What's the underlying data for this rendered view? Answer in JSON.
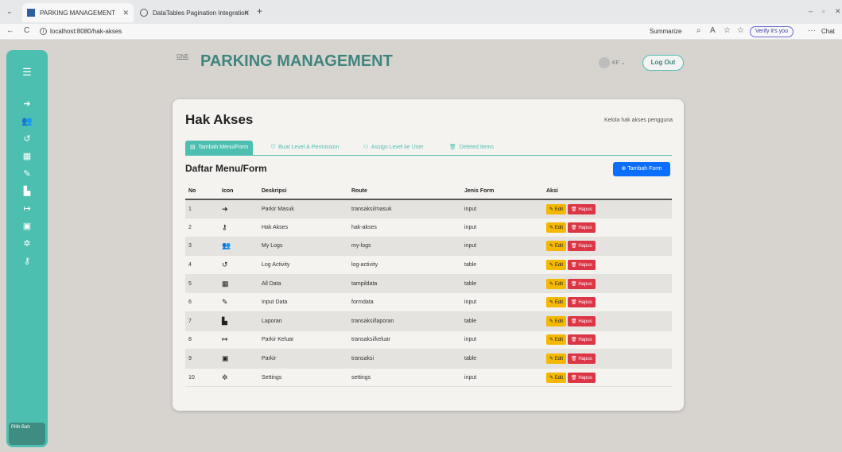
{
  "browser": {
    "tabs": [
      {
        "label": "PARKING MANAGEMENT"
      },
      {
        "label": "DataTables Pagination Integration"
      }
    ],
    "url": "localhost:8080/hak-akses",
    "summarize_label": "Summarize",
    "verify_label": "Verify it's you",
    "chat_label": "Chat"
  },
  "header": {
    "logo_text": "ONE",
    "title": "PARKING MANAGEMENT",
    "user": "KF",
    "logout_label": "Log Out"
  },
  "sidebar": {
    "bottom_label": "Pilih Bah",
    "items": [
      "menu",
      "sign-in",
      "users",
      "history",
      "table",
      "pencil",
      "file",
      "sign-out",
      "square",
      "gear",
      "key"
    ]
  },
  "card": {
    "title": "Hak Akses",
    "subtitle": "Kelola hak akses pengguna",
    "tabs": [
      {
        "label": "Tambah Menu/Form"
      },
      {
        "label": "Buat Level & Permission"
      },
      {
        "label": "Assign Level ke User"
      },
      {
        "label": "Deleted Items"
      }
    ],
    "list_title": "Daftar Menu/Form",
    "add_button": "Tambah Form"
  },
  "table": {
    "columns": [
      "No",
      "Icon",
      "Deskripsi",
      "Route",
      "Jenis Form",
      "Aksi"
    ],
    "edit_label": "Edit",
    "delete_label": "Hapus",
    "rows": [
      {
        "no": "1",
        "icon": "sign-in-icon",
        "deskripsi": "Parkir Masuk",
        "route": "transaksi/masuk",
        "jenis": "input"
      },
      {
        "no": "2",
        "icon": "key-icon",
        "deskripsi": "Hak Akses",
        "route": "hak-akses",
        "jenis": "input"
      },
      {
        "no": "3",
        "icon": "users-icon",
        "deskripsi": "My Logs",
        "route": "my-logs",
        "jenis": "input"
      },
      {
        "no": "4",
        "icon": "history-icon",
        "deskripsi": "Log Activity",
        "route": "log-activity",
        "jenis": "table"
      },
      {
        "no": "5",
        "icon": "table-icon",
        "deskripsi": "All Data",
        "route": "tampildata",
        "jenis": "table"
      },
      {
        "no": "6",
        "icon": "pencil-icon",
        "deskripsi": "Input Data",
        "route": "formdata",
        "jenis": "input"
      },
      {
        "no": "7",
        "icon": "file-icon",
        "deskripsi": "Laporan",
        "route": "transaksi/laporan",
        "jenis": "table"
      },
      {
        "no": "8",
        "icon": "sign-out-icon",
        "deskripsi": "Parkir Keluar",
        "route": "transaksi/keluar",
        "jenis": "input"
      },
      {
        "no": "9",
        "icon": "square-icon",
        "deskripsi": "Parkir",
        "route": "transaksi",
        "jenis": "table"
      },
      {
        "no": "10",
        "icon": "gear-icon",
        "deskripsi": "Settings",
        "route": "settings",
        "jenis": "input"
      }
    ]
  }
}
